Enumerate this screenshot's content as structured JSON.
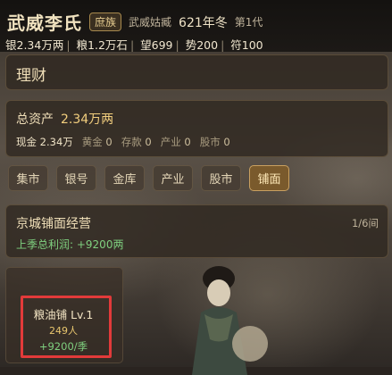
{
  "header": {
    "clan_name": "武威李氏",
    "clan_badge": "庶族",
    "place": "武威姑臧",
    "year": "621年冬",
    "generation": "第1代",
    "stats": {
      "silver": "银2.34万两",
      "grain": "粮1.2万石",
      "prestige": "望699",
      "power": "势200",
      "talisman": "符100"
    }
  },
  "page": {
    "title": "理财"
  },
  "assets": {
    "title": "总资产",
    "total": "2.34万两",
    "items": [
      {
        "label": "现金",
        "value": "2.34万"
      },
      {
        "label": "黄金",
        "value": "0"
      },
      {
        "label": "存款",
        "value": "0"
      },
      {
        "label": "产业",
        "value": "0"
      },
      {
        "label": "股市",
        "value": "0"
      }
    ]
  },
  "tabs": [
    "集市",
    "银号",
    "金库",
    "产业",
    "股市",
    "铺面"
  ],
  "active_tab": "铺面",
  "market": {
    "title": "京城铺面经营",
    "page": "1/6间",
    "profit": "上季总利润: +9200两"
  },
  "shop": {
    "name": "粮油铺 Lv.1",
    "people": "249人",
    "income": "+9200/季"
  },
  "colors": {
    "accent": "#c9a060",
    "profit_green": "#7fd07f",
    "highlight_red": "#e23a3a"
  }
}
